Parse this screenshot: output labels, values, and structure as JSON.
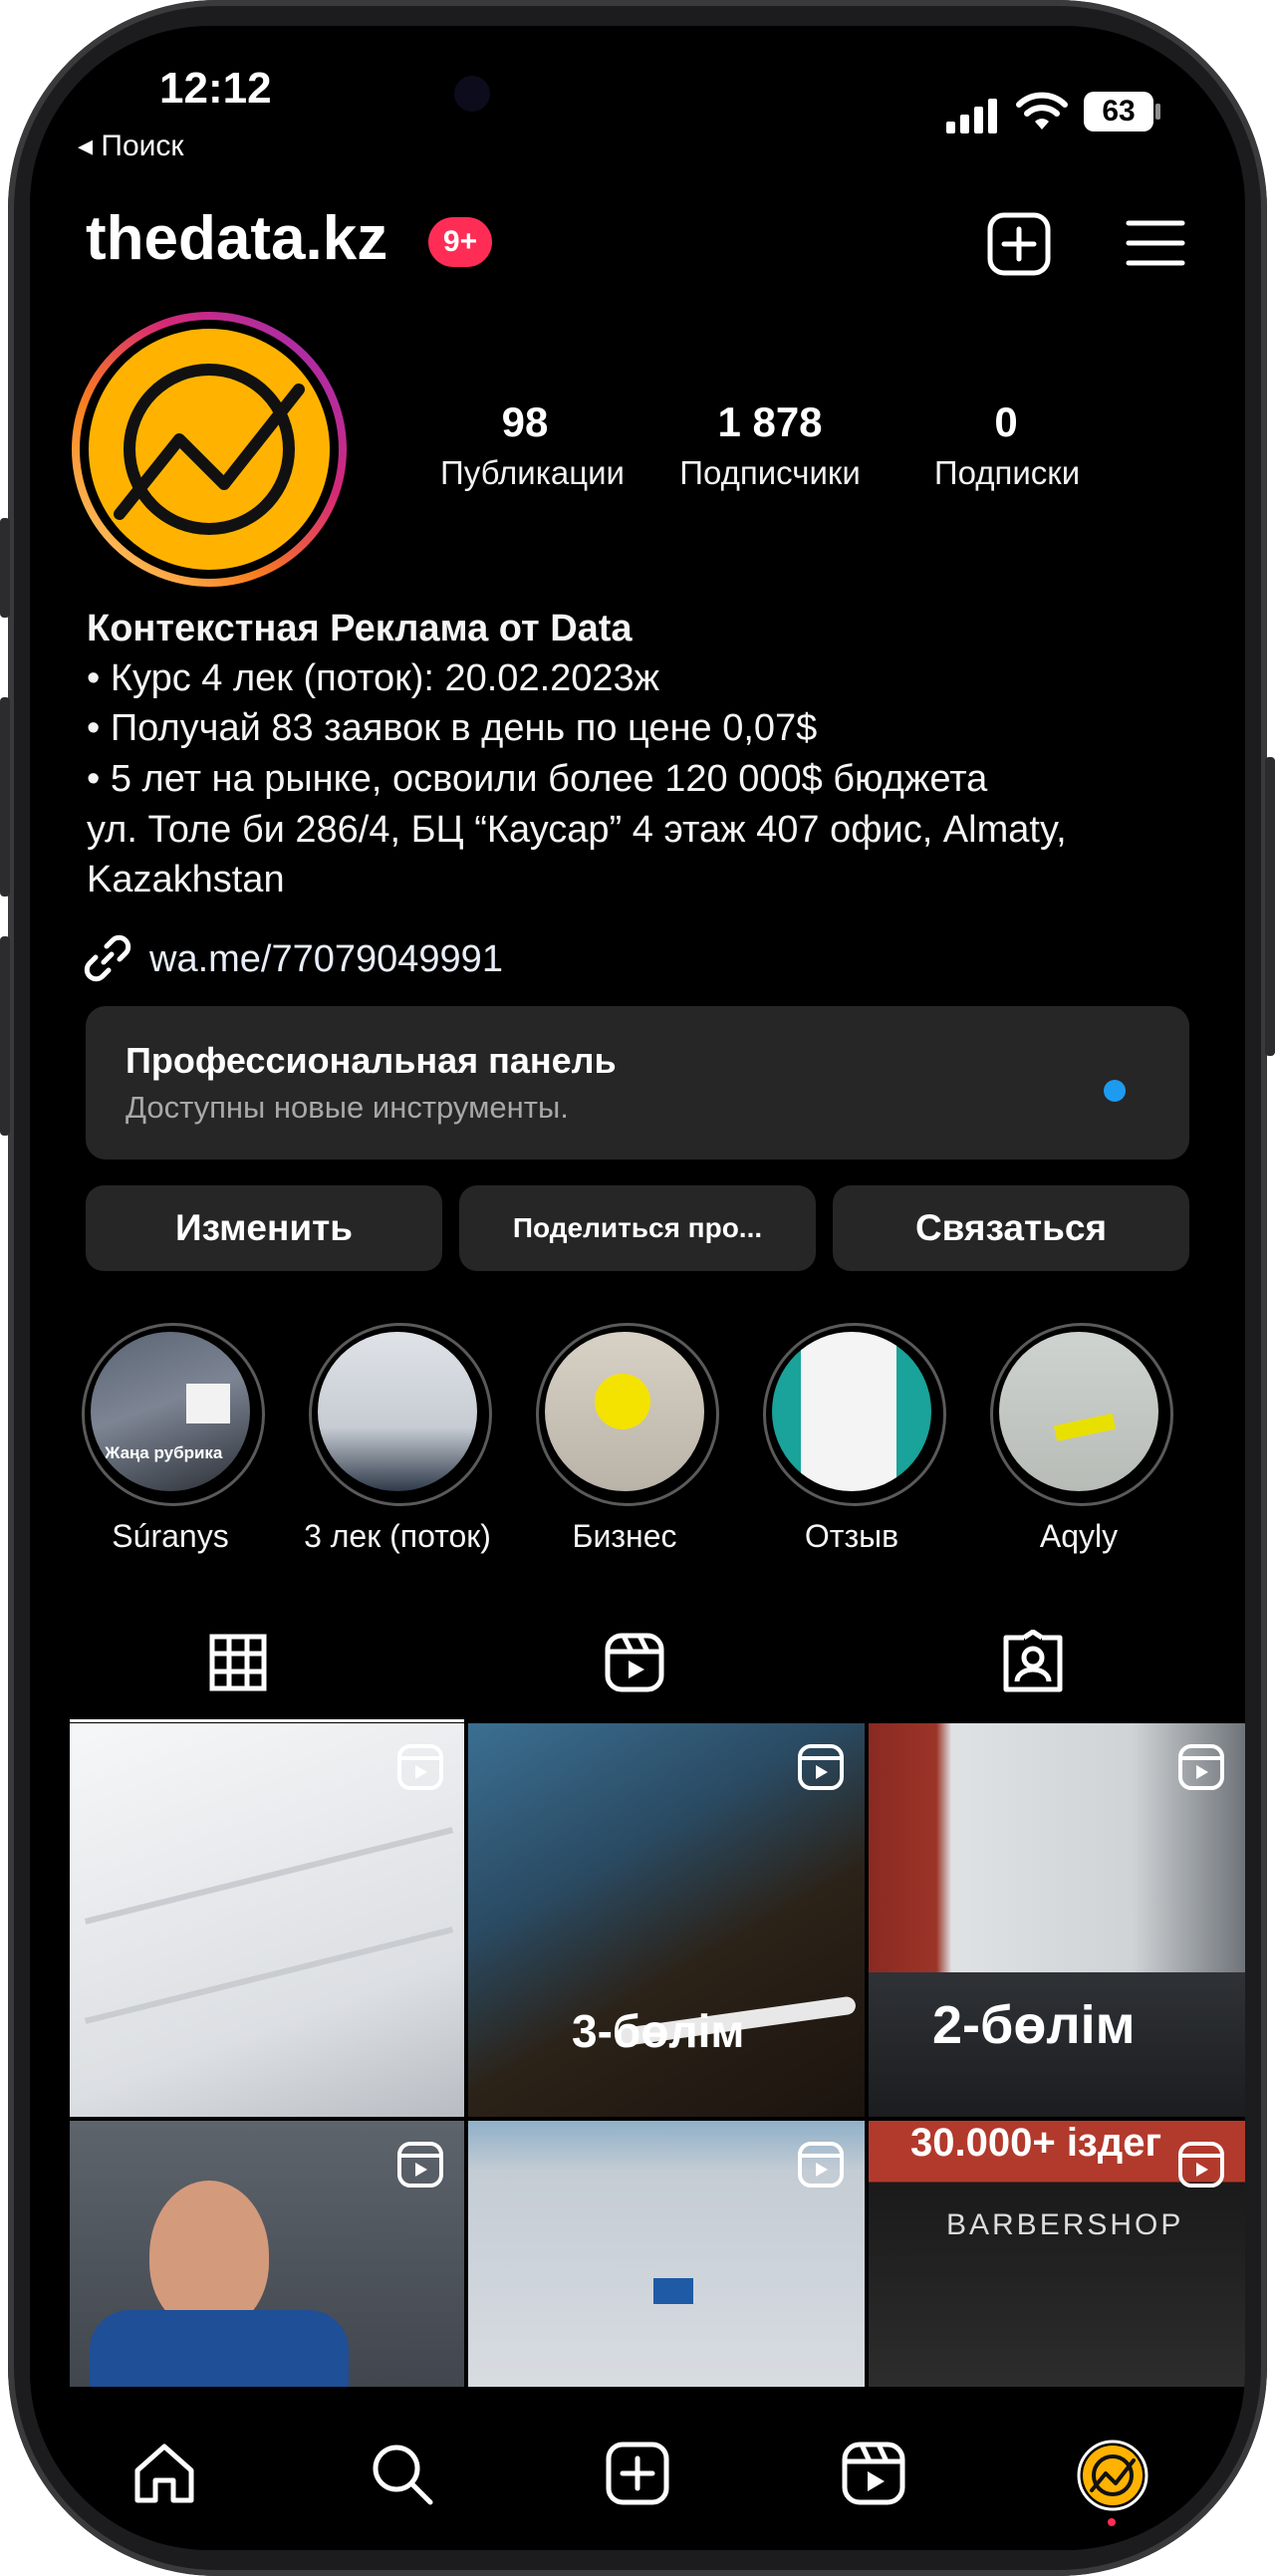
{
  "status_bar": {
    "time": "12:12",
    "back_label": "◂ Поиск",
    "battery": "63"
  },
  "header": {
    "username": "thedata.kz",
    "notification_badge": "9+"
  },
  "stats": [
    {
      "value": "98",
      "label": "Публикации"
    },
    {
      "value": "1 878",
      "label": "Подписчики"
    },
    {
      "value": "0",
      "label": "Подписки"
    }
  ],
  "bio": {
    "name": "Контекстная Реклама от Data",
    "lines": [
      "• Курс 4 лек (поток): 20.02.2023ж",
      "• Получай 83 заявок в день по цене 0,07$",
      "• 5 лет на рынке, освоили более 120 000$ бюджета",
      "ул. Толе би 286/4, БЦ “Каусар” 4 этаж 407 офис, Almaty,",
      "Kazakhstan"
    ],
    "link": "wa.me/77079049991"
  },
  "pro_panel": {
    "title": "Профессиональная панель",
    "subtitle": "Доступны новые инструменты."
  },
  "buttons": {
    "edit": "Изменить",
    "share": "Поделиться про...",
    "contact": "Связаться"
  },
  "highlights": [
    {
      "label": "Súranys",
      "overlay_text": "Жаңа рубрика"
    },
    {
      "label": "3 лек (поток)"
    },
    {
      "label": "Бизнес"
    },
    {
      "label": "Отзыв"
    },
    {
      "label": "Aqyly"
    }
  ],
  "grid_overlays": {
    "tile2": "3-бөлім",
    "tile3": "2-бөлім",
    "tile6_top": "30.000+ іздег",
    "tile6_sign": "BARBERSHOP"
  },
  "colors": {
    "accent_blue": "#1d9bf0",
    "badge_red": "#ff2d55",
    "logo_yellow": "#ffb300"
  },
  "icons": [
    "link-icon",
    "grid-icon",
    "reels-icon",
    "tagged-icon",
    "home-icon",
    "search-icon",
    "new-post-icon",
    "menu-icon"
  ]
}
